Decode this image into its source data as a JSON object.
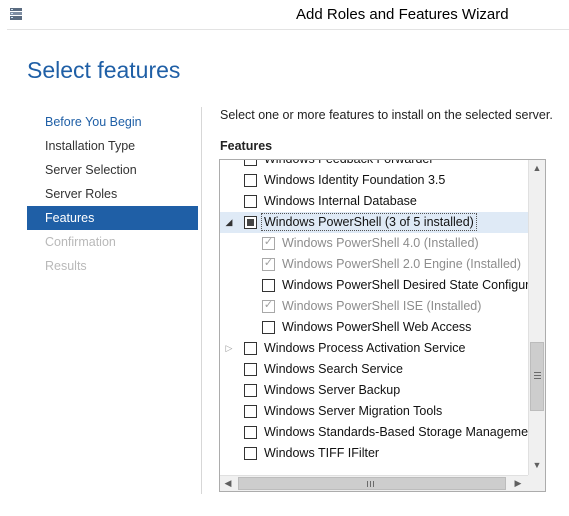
{
  "window": {
    "title": "Add Roles and Features Wizard",
    "icon": "server-manager-icon"
  },
  "page": {
    "title": "Select features"
  },
  "nav": {
    "items": [
      {
        "label": "Before You Begin",
        "state": "link"
      },
      {
        "label": "Installation Type",
        "state": "normal"
      },
      {
        "label": "Server Selection",
        "state": "normal"
      },
      {
        "label": "Server Roles",
        "state": "normal"
      },
      {
        "label": "Features",
        "state": "selected"
      },
      {
        "label": "Confirmation",
        "state": "disabled"
      },
      {
        "label": "Results",
        "state": "disabled"
      }
    ]
  },
  "main": {
    "instruction": "Select one or more features to install on the selected server.",
    "features_label": "Features"
  },
  "features": [
    {
      "label": "Windows Feedback Forwarder",
      "level": 0,
      "checked": "unchecked"
    },
    {
      "label": "Windows Identity Foundation 3.5",
      "level": 0,
      "checked": "unchecked"
    },
    {
      "label": "Windows Internal Database",
      "level": 0,
      "checked": "unchecked"
    },
    {
      "label": "Windows PowerShell (3 of 5 installed)",
      "level": 0,
      "checked": "partial",
      "expander": "expanded",
      "highlighted": true
    },
    {
      "label": "Windows PowerShell 4.0 (Installed)",
      "level": 1,
      "checked": "checked",
      "installed": true
    },
    {
      "label": "Windows PowerShell 2.0 Engine (Installed)",
      "level": 1,
      "checked": "checked",
      "installed": true
    },
    {
      "label": "Windows PowerShell Desired State Configurati",
      "level": 1,
      "checked": "unchecked"
    },
    {
      "label": "Windows PowerShell ISE (Installed)",
      "level": 1,
      "checked": "checked",
      "installed": true
    },
    {
      "label": "Windows PowerShell Web Access",
      "level": 1,
      "checked": "unchecked"
    },
    {
      "label": "Windows Process Activation Service",
      "level": 0,
      "checked": "unchecked",
      "expander": "collapsed"
    },
    {
      "label": "Windows Search Service",
      "level": 0,
      "checked": "unchecked"
    },
    {
      "label": "Windows Server Backup",
      "level": 0,
      "checked": "unchecked"
    },
    {
      "label": "Windows Server Migration Tools",
      "level": 0,
      "checked": "unchecked"
    },
    {
      "label": "Windows Standards-Based Storage Management",
      "level": 0,
      "checked": "unchecked"
    },
    {
      "label": "Windows TIFF IFilter",
      "level": 0,
      "checked": "unchecked"
    }
  ],
  "scrollbars": {
    "vertical_position": 0.78,
    "horizontal_position": 0.0
  },
  "colors": {
    "accent": "#1f5fa6",
    "row_highlight": "#dfeaf6",
    "disabled_text": "#b9b9b9"
  }
}
